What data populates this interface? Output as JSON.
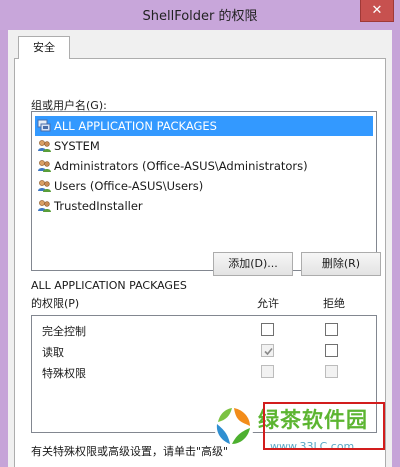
{
  "window": {
    "title": "ShellFolder 的权限",
    "close_glyph": "✕"
  },
  "tabs": [
    {
      "label": "安全"
    }
  ],
  "group_label": "组或用户名(G):",
  "users": [
    {
      "name": "ALL APPLICATION PACKAGES",
      "icon": "package-group-icon",
      "selected": true
    },
    {
      "name": "SYSTEM",
      "icon": "users-group-icon",
      "selected": false
    },
    {
      "name": "Administrators (Office-ASUS\\Administrators)",
      "icon": "users-group-icon",
      "selected": false
    },
    {
      "name": "Users (Office-ASUS\\Users)",
      "icon": "users-group-icon",
      "selected": false
    },
    {
      "name": "TrustedInstaller",
      "icon": "users-group-icon",
      "selected": false
    }
  ],
  "buttons": {
    "add": "添加(D)...",
    "remove": "删除(R)"
  },
  "permissions": {
    "heading_line1": "ALL APPLICATION PACKAGES",
    "heading_line2": "的权限(P)",
    "col_allow": "允许",
    "col_deny": "拒绝",
    "rows": [
      {
        "name": "完全控制",
        "allow": false,
        "deny": false,
        "allow_disabled": false,
        "deny_disabled": false
      },
      {
        "name": "读取",
        "allow": true,
        "deny": false,
        "allow_disabled": true,
        "deny_disabled": false
      },
      {
        "name": "特殊权限",
        "allow": false,
        "deny": false,
        "allow_disabled": true,
        "deny_disabled": true
      }
    ]
  },
  "footer_text": "有关特殊权限或高级设置，请单击\"高级\"",
  "watermark": {
    "text": "绿茶软件园",
    "url": "www.33LC.com"
  },
  "colors": {
    "title_bar": "#c8a6da",
    "selection": "#3399ff",
    "close_button": "#c7514f",
    "watermark_green": "#5cb531"
  }
}
